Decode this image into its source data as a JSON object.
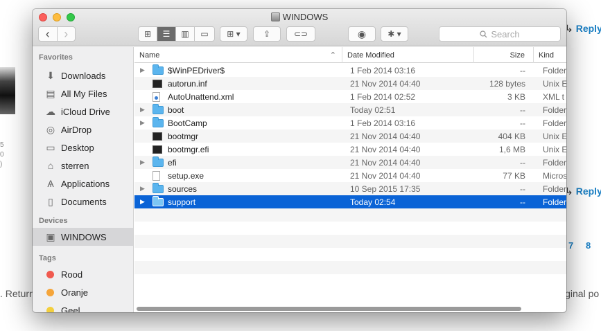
{
  "window": {
    "title": "WINDOWS"
  },
  "toolbar": {
    "back": "‹",
    "forward": "›",
    "view_icons": "⊞",
    "view_list": "☰",
    "view_columns": "▥",
    "view_coverflow": "▭",
    "arrange": "⊞ ▾",
    "share": "⇪",
    "tag": "⊂⊃",
    "quicklook": "◉",
    "action": "✱ ▾",
    "search_placeholder": "Search"
  },
  "sidebar": {
    "favorites_heading": "Favorites",
    "favorites": [
      {
        "label": "Downloads",
        "icon": "downloads-icon",
        "glyph": "⬇"
      },
      {
        "label": "All My Files",
        "icon": "all-files-icon",
        "glyph": "▤"
      },
      {
        "label": "iCloud Drive",
        "icon": "cloud-icon",
        "glyph": "☁"
      },
      {
        "label": "AirDrop",
        "icon": "airdrop-icon",
        "glyph": "◎"
      },
      {
        "label": "Desktop",
        "icon": "desktop-icon",
        "glyph": "▭"
      },
      {
        "label": "sterren",
        "icon": "home-icon",
        "glyph": "⌂"
      },
      {
        "label": "Applications",
        "icon": "applications-icon",
        "glyph": "Ѧ"
      },
      {
        "label": "Documents",
        "icon": "documents-icon",
        "glyph": "▯"
      }
    ],
    "devices_heading": "Devices",
    "devices": [
      {
        "label": "WINDOWS",
        "icon": "disk-icon",
        "glyph": "▣"
      }
    ],
    "tags_heading": "Tags",
    "tags": [
      {
        "label": "Rood",
        "color": "#f05a4f"
      },
      {
        "label": "Oranje",
        "color": "#f5a53a"
      },
      {
        "label": "Geel",
        "color": "#f3cf3d"
      }
    ]
  },
  "list": {
    "columns": {
      "name": "Name",
      "date": "Date Modified",
      "size": "Size",
      "kind": "Kind"
    },
    "rows": [
      {
        "name": "$WinPEDriver$",
        "date": "1 Feb 2014 03:16",
        "size": "--",
        "kind": "Folder",
        "type": "folder",
        "expandable": true
      },
      {
        "name": "autorun.inf",
        "date": "21 Nov 2014 04:40",
        "size": "128 bytes",
        "kind": "Unix E",
        "type": "exec",
        "expandable": false
      },
      {
        "name": "AutoUnattend.xml",
        "date": "1 Feb 2014 02:52",
        "size": "3 KB",
        "kind": "XML t",
        "type": "xml",
        "expandable": false
      },
      {
        "name": "boot",
        "date": "Today 02:51",
        "size": "--",
        "kind": "Folder",
        "type": "folder",
        "expandable": true
      },
      {
        "name": "BootCamp",
        "date": "1 Feb 2014 03:16",
        "size": "--",
        "kind": "Folder",
        "type": "folder",
        "expandable": true
      },
      {
        "name": "bootmgr",
        "date": "21 Nov 2014 04:40",
        "size": "404 KB",
        "kind": "Unix E",
        "type": "exec",
        "expandable": false
      },
      {
        "name": "bootmgr.efi",
        "date": "21 Nov 2014 04:40",
        "size": "1,6 MB",
        "kind": "Unix E",
        "type": "exec",
        "expandable": false
      },
      {
        "name": "efi",
        "date": "21 Nov 2014 04:40",
        "size": "--",
        "kind": "Folder",
        "type": "folder",
        "expandable": true
      },
      {
        "name": "setup.exe",
        "date": "21 Nov 2014 04:40",
        "size": "77 KB",
        "kind": "Micros",
        "type": "doc",
        "expandable": false
      },
      {
        "name": "sources",
        "date": "10 Sep 2015 17:35",
        "size": "--",
        "kind": "Folder",
        "type": "folder",
        "expandable": true
      },
      {
        "name": "support",
        "date": "Today 02:54",
        "size": "--",
        "kind": "Folder",
        "type": "folder",
        "expandable": true,
        "selected": true
      }
    ]
  },
  "background": {
    "reply": "Reply",
    "return_text": ". Return",
    "original_text": "iginal po",
    "pages": [
      "7",
      "8"
    ],
    "nums": [
      "5",
      "0",
      ")"
    ]
  }
}
